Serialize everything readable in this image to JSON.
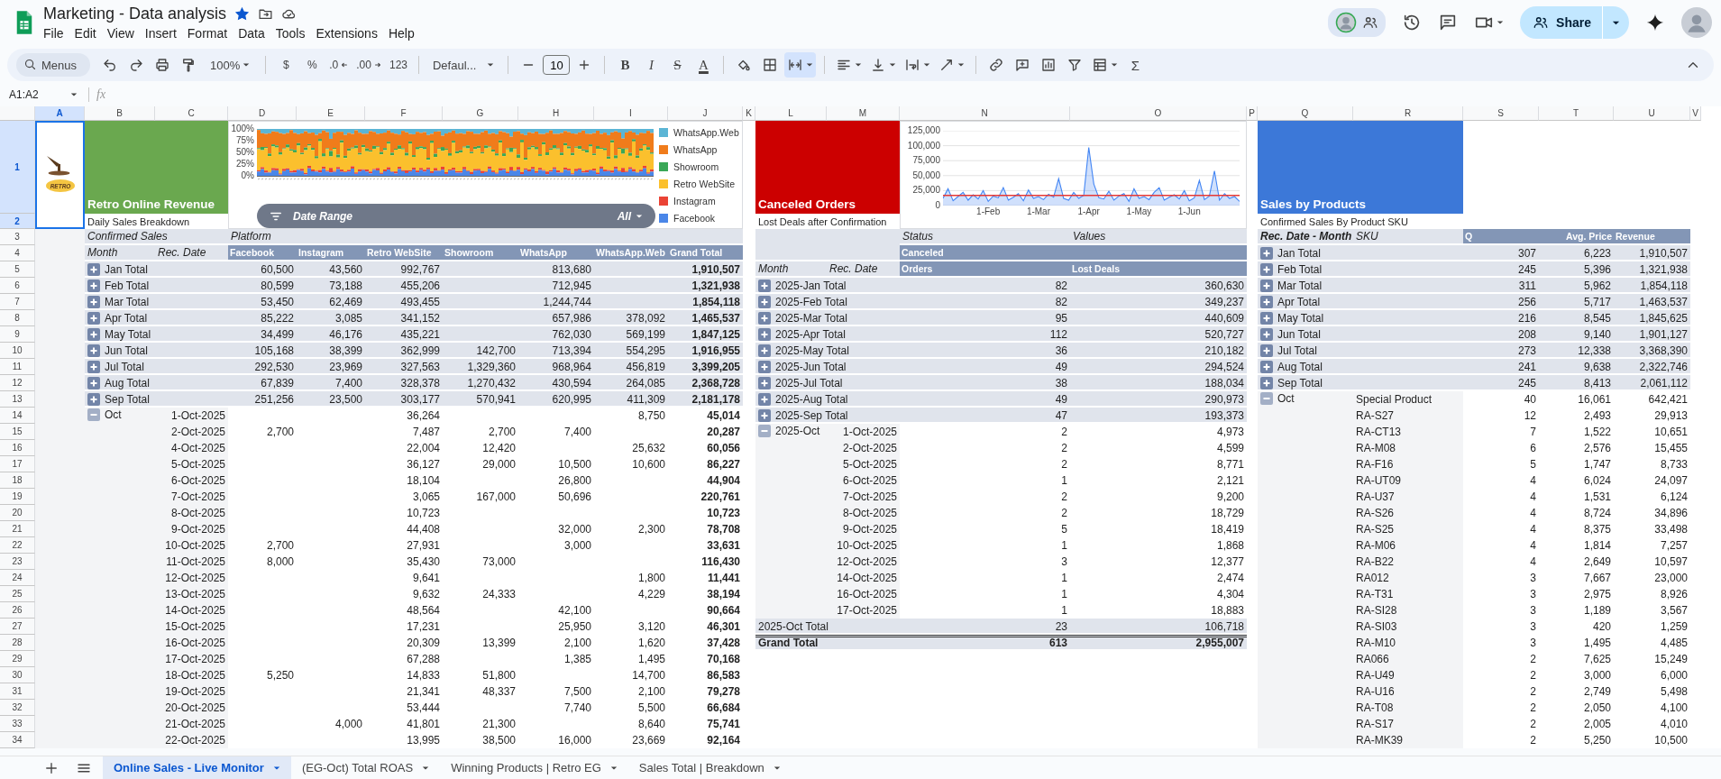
{
  "document": {
    "title": "Marketing - Data analysis",
    "starred": true,
    "menus": [
      "File",
      "Edit",
      "View",
      "Insert",
      "Format",
      "Data",
      "Tools",
      "Extensions",
      "Help"
    ]
  },
  "header": {
    "share_label": "Share"
  },
  "toolbar": {
    "search_placeholder": "Menus",
    "zoom": "100%",
    "number_formats": [
      "$",
      "%",
      ".0",
      ".00",
      "123"
    ],
    "font": "Defaul...",
    "font_size": "10",
    "text_styles": [
      "B",
      "I",
      "S",
      "A"
    ],
    "merge_on": true,
    "function": "Σ"
  },
  "formula_bar": {
    "name_box": "A1:A2",
    "function_label": "fx"
  },
  "columns": [
    {
      "label": "A",
      "selected": true
    },
    {
      "label": "B",
      "selected": false
    },
    {
      "label": "C",
      "selected": false
    },
    {
      "label": "D",
      "selected": false
    },
    {
      "label": "E",
      "selected": false
    },
    {
      "label": "F",
      "selected": false
    },
    {
      "label": "G",
      "selected": false
    },
    {
      "label": "H",
      "selected": false
    },
    {
      "label": "I",
      "selected": false
    },
    {
      "label": "J",
      "selected": false
    },
    {
      "label": "K",
      "selected": false
    },
    {
      "label": "L",
      "selected": false
    },
    {
      "label": "M",
      "selected": false
    },
    {
      "label": "N",
      "selected": false
    },
    {
      "label": "O",
      "selected": false
    },
    {
      "label": "P",
      "selected": false
    },
    {
      "label": "Q",
      "selected": false
    },
    {
      "label": "R",
      "selected": false
    },
    {
      "label": "S",
      "selected": false
    },
    {
      "label": "T",
      "selected": false
    },
    {
      "label": "U",
      "selected": false
    },
    {
      "label": "V",
      "selected": false
    }
  ],
  "rows": [
    {
      "label": "1",
      "selected": true
    },
    {
      "label": "2",
      "selected": true
    },
    {
      "label": "3",
      "selected": false
    },
    {
      "label": "4",
      "selected": false
    },
    {
      "label": "5",
      "selected": false
    },
    {
      "label": "6",
      "selected": false
    },
    {
      "label": "7",
      "selected": false
    },
    {
      "label": "8",
      "selected": false
    },
    {
      "label": "9",
      "selected": false
    },
    {
      "label": "10",
      "selected": false
    },
    {
      "label": "11",
      "selected": false
    },
    {
      "label": "12",
      "selected": false
    },
    {
      "label": "13",
      "selected": false
    },
    {
      "label": "14",
      "selected": false
    },
    {
      "label": "15",
      "selected": false
    },
    {
      "label": "16",
      "selected": false
    },
    {
      "label": "17",
      "selected": false
    },
    {
      "label": "18",
      "selected": false
    },
    {
      "label": "19",
      "selected": false
    },
    {
      "label": "20",
      "selected": false
    },
    {
      "label": "21",
      "selected": false
    },
    {
      "label": "22",
      "selected": false
    },
    {
      "label": "23",
      "selected": false
    },
    {
      "label": "24",
      "selected": false
    },
    {
      "label": "25",
      "selected": false
    },
    {
      "label": "26",
      "selected": false
    },
    {
      "label": "27",
      "selected": false
    },
    {
      "label": "28",
      "selected": false
    },
    {
      "label": "29",
      "selected": false
    },
    {
      "label": "30",
      "selected": false
    },
    {
      "label": "31",
      "selected": false
    },
    {
      "label": "32",
      "selected": false
    },
    {
      "label": "33",
      "selected": false
    },
    {
      "label": "34",
      "selected": false
    }
  ],
  "logo": {
    "text": "RETRO"
  },
  "cards": [
    {
      "title": "Retro Online Revenue",
      "subtitle": "Daily Sales Breakdown",
      "color": "#6aa84f"
    },
    {
      "title": "Canceled Orders",
      "subtitle": "Lost Deals after Confirmation",
      "color": "#cc0000"
    },
    {
      "title": "Sales by Products",
      "subtitle": "Confirmed Sales By Product SKU",
      "color": "#3c78d8"
    }
  ],
  "platform_chart": {
    "yticks": [
      "100%",
      "75%",
      "50%",
      "25%",
      "0%"
    ],
    "legend": [
      {
        "label": "WhatsApp.Web",
        "color": "#5bb5d5"
      },
      {
        "label": "WhatsApp",
        "color": "#f07c1b"
      },
      {
        "label": "Showroom",
        "color": "#3aa757"
      },
      {
        "label": "Retro WebSite",
        "color": "#fbc02d"
      },
      {
        "label": "Instagram",
        "color": "#ea4335"
      },
      {
        "label": "Facebook",
        "color": "#4a86e8"
      }
    ],
    "date_filter": {
      "label": "Date Range",
      "value": "All"
    }
  },
  "cancel_chart": {
    "chart_data": {
      "type": "line",
      "categories": [
        null,
        null,
        null,
        null,
        null,
        null,
        null,
        null,
        null,
        "1-Feb",
        null,
        null,
        null,
        null,
        null,
        null,
        null,
        null,
        null,
        "1-Mar",
        null,
        null,
        null,
        null,
        null,
        null,
        null,
        null,
        null,
        "1-Apr",
        null,
        null,
        null,
        null,
        null,
        null,
        null,
        null,
        null,
        "1-May",
        null,
        null,
        null,
        null,
        null,
        null,
        null,
        null,
        null,
        "1-Jun",
        null,
        null,
        null,
        null,
        null,
        null,
        null,
        null,
        null,
        null
      ],
      "grid": true,
      "series": [
        {
          "type": "area",
          "color": "#4285f4",
          "values": [
            12000,
            28000,
            8000,
            15000,
            22000,
            9000,
            18000,
            11000,
            25000,
            7000,
            16000,
            13000,
            30000,
            9000,
            14000,
            20000,
            8000,
            26000,
            12000,
            15000,
            10000,
            19000,
            14000,
            45000,
            12000,
            9000,
            22000,
            12000,
            17000,
            97000,
            36000,
            13000,
            11000,
            24000,
            9000,
            16000,
            20000,
            7000,
            28000,
            12000,
            15000,
            10000,
            22000,
            30000,
            9000,
            14000,
            18000,
            11000,
            25000,
            8000,
            13000,
            42000,
            10000,
            16000,
            58000,
            9000,
            20000,
            12000,
            15000,
            7000
          ]
        },
        {
          "color": "#e53935",
          "values": [
            17000,
            17000,
            17000,
            17000,
            17000,
            17000,
            17000,
            17000,
            17000,
            17000,
            17000,
            17000,
            17000,
            17000,
            17000,
            17000,
            17000,
            17000,
            17000,
            17000,
            17000,
            17000,
            17000,
            17000,
            17000,
            17000,
            17000,
            17000,
            17000,
            17000,
            17000,
            17000,
            17000,
            17000,
            17000,
            17000,
            17000,
            17000,
            17000,
            17000,
            17000,
            17000,
            17000,
            17000,
            17000,
            17000,
            17000,
            17000,
            17000,
            17000,
            17000,
            17000,
            17000,
            17000,
            17000,
            17000,
            17000,
            17000,
            17000,
            17000
          ]
        }
      ],
      "ylim": [
        0,
        125000
      ],
      "yticks": [
        {
          "value": 0,
          "label": "0"
        },
        {
          "value": 25000,
          "label": "25,000"
        },
        {
          "value": 50000,
          "label": "50,000"
        },
        {
          "value": 75000,
          "label": "75,000"
        },
        {
          "value": 100000,
          "label": "100,000"
        },
        {
          "value": 125000,
          "label": "125,000"
        }
      ]
    }
  },
  "sales_pivot": {
    "corner": "Confirmed Sales",
    "column_field": "Platform",
    "row_fields": [
      "Month",
      "Rec. Date"
    ],
    "columns": [
      "Facebook",
      "Instagram",
      "Retro WebSite",
      "Showroom",
      "WhatsApp",
      "WhatsApp.Web",
      "Grand Total"
    ],
    "groups": [
      {
        "label": "Jan Total",
        "expanded": false,
        "cells": [
          {
            "value": "60,500"
          },
          {
            "value": "43,560"
          },
          {
            "value": "992,767"
          },
          {},
          {
            "value": "813,680"
          },
          {},
          {
            "value": "1,910,507"
          }
        ]
      },
      {
        "label": "Feb Total",
        "expanded": false,
        "cells": [
          {
            "value": "80,599"
          },
          {
            "value": "73,188"
          },
          {
            "value": "455,206"
          },
          {},
          {
            "value": "712,945"
          },
          {},
          {
            "value": "1,321,938"
          }
        ]
      },
      {
        "label": "Mar Total",
        "expanded": false,
        "cells": [
          {
            "value": "53,450"
          },
          {
            "value": "62,469"
          },
          {
            "value": "493,455"
          },
          {},
          {
            "value": "1,244,744"
          },
          {},
          {
            "value": "1,854,118"
          }
        ]
      },
      {
        "label": "Apr Total",
        "expanded": false,
        "cells": [
          {
            "value": "85,222"
          },
          {
            "value": "3,085"
          },
          {
            "value": "341,152"
          },
          {},
          {
            "value": "657,986"
          },
          {
            "value": "378,092"
          },
          {
            "value": "1,465,537"
          }
        ]
      },
      {
        "label": "May Total",
        "expanded": false,
        "cells": [
          {
            "value": "34,499"
          },
          {
            "value": "46,176"
          },
          {
            "value": "435,221"
          },
          {},
          {
            "value": "762,030"
          },
          {
            "value": "569,199"
          },
          {
            "value": "1,847,125"
          }
        ]
      },
      {
        "label": "Jun Total",
        "expanded": false,
        "cells": [
          {
            "value": "105,168"
          },
          {
            "value": "38,399"
          },
          {
            "value": "362,999"
          },
          {
            "value": "142,700"
          },
          {
            "value": "713,394"
          },
          {
            "value": "554,295"
          },
          {
            "value": "1,916,955"
          }
        ]
      },
      {
        "label": "Jul Total",
        "expanded": false,
        "cells": [
          {
            "value": "292,530"
          },
          {
            "value": "23,969"
          },
          {
            "value": "327,563"
          },
          {
            "value": "1,329,360"
          },
          {
            "value": "968,964"
          },
          {
            "value": "456,819"
          },
          {
            "value": "3,399,205"
          }
        ]
      },
      {
        "label": "Aug Total",
        "expanded": false,
        "cells": [
          {
            "value": "67,839"
          },
          {
            "value": "7,400"
          },
          {
            "value": "328,378"
          },
          {
            "value": "1,270,432"
          },
          {
            "value": "430,594"
          },
          {
            "value": "264,085"
          },
          {
            "value": "2,368,728"
          }
        ]
      },
      {
        "label": "Sep Total",
        "expanded": false,
        "cells": [
          {
            "value": "251,256"
          },
          {
            "value": "23,500"
          },
          {
            "value": "303,177"
          },
          {
            "value": "570,941"
          },
          {
            "value": "620,995"
          },
          {
            "value": "411,309"
          },
          {
            "value": "2,181,178"
          }
        ]
      },
      {
        "label": "Oct",
        "expanded": true,
        "children": [
          {
            "label": "1-Oct-2025",
            "cells": [
              {},
              {},
              {
                "value": "36,264"
              },
              {},
              {},
              {
                "value": "8,750"
              },
              {
                "value": "45,014"
              }
            ]
          },
          {
            "label": "2-Oct-2025",
            "cells": [
              {
                "value": "2,700"
              },
              {},
              {
                "value": "7,487"
              },
              {
                "value": "2,700"
              },
              {
                "value": "7,400"
              },
              {},
              {
                "value": "20,287"
              }
            ]
          },
          {
            "label": "4-Oct-2025",
            "cells": [
              {},
              {},
              {
                "value": "22,004"
              },
              {
                "value": "12,420"
              },
              {},
              {
                "value": "25,632"
              },
              {
                "value": "60,056"
              }
            ]
          },
          {
            "label": "5-Oct-2025",
            "cells": [
              {},
              {},
              {
                "value": "36,127"
              },
              {
                "value": "29,000"
              },
              {
                "value": "10,500"
              },
              {
                "value": "10,600"
              },
              {
                "value": "86,227"
              }
            ]
          },
          {
            "label": "6-Oct-2025",
            "cells": [
              {},
              {},
              {
                "value": "18,104"
              },
              {},
              {
                "value": "26,800"
              },
              {},
              {
                "value": "44,904"
              }
            ]
          },
          {
            "label": "7-Oct-2025",
            "cells": [
              {},
              {},
              {
                "value": "3,065"
              },
              {
                "value": "167,000"
              },
              {
                "value": "50,696"
              },
              {},
              {
                "value": "220,761"
              }
            ]
          },
          {
            "label": "8-Oct-2025",
            "cells": [
              {},
              {},
              {
                "value": "10,723"
              },
              {},
              {},
              {},
              {
                "value": "10,723"
              }
            ]
          },
          {
            "label": "9-Oct-2025",
            "cells": [
              {},
              {},
              {
                "value": "44,408"
              },
              {},
              {
                "value": "32,000"
              },
              {
                "value": "2,300"
              },
              {
                "value": "78,708"
              }
            ]
          },
          {
            "label": "10-Oct-2025",
            "cells": [
              {
                "value": "2,700"
              },
              {},
              {
                "value": "27,931"
              },
              {},
              {
                "value": "3,000"
              },
              {},
              {
                "value": "33,631"
              }
            ]
          },
          {
            "label": "11-Oct-2025",
            "cells": [
              {
                "value": "8,000"
              },
              {},
              {
                "value": "35,430"
              },
              {
                "value": "73,000"
              },
              {},
              {},
              {
                "value": "116,430"
              }
            ]
          },
          {
            "label": "12-Oct-2025",
            "cells": [
              {},
              {},
              {
                "value": "9,641"
              },
              {},
              {},
              {
                "value": "1,800"
              },
              {
                "value": "11,441"
              }
            ]
          },
          {
            "label": "13-Oct-2025",
            "cells": [
              {},
              {},
              {
                "value": "9,632"
              },
              {
                "value": "24,333"
              },
              {},
              {
                "value": "4,229"
              },
              {
                "value": "38,194"
              }
            ]
          },
          {
            "label": "14-Oct-2025",
            "cells": [
              {},
              {},
              {
                "value": "48,564"
              },
              {},
              {
                "value": "42,100"
              },
              {},
              {
                "value": "90,664"
              }
            ]
          },
          {
            "label": "15-Oct-2025",
            "cells": [
              {},
              {},
              {
                "value": "17,231"
              },
              {},
              {
                "value": "25,950"
              },
              {
                "value": "3,120"
              },
              {
                "value": "46,301"
              }
            ]
          },
          {
            "label": "16-Oct-2025",
            "cells": [
              {},
              {},
              {
                "value": "20,309"
              },
              {
                "value": "13,399"
              },
              {
                "value": "2,100"
              },
              {
                "value": "1,620"
              },
              {
                "value": "37,428"
              }
            ]
          },
          {
            "label": "17-Oct-2025",
            "cells": [
              {},
              {},
              {
                "value": "67,288"
              },
              {},
              {
                "value": "1,385"
              },
              {
                "value": "1,495"
              },
              {
                "value": "70,168"
              }
            ]
          },
          {
            "label": "18-Oct-2025",
            "cells": [
              {
                "value": "5,250"
              },
              {},
              {
                "value": "14,833"
              },
              {
                "value": "51,800"
              },
              {},
              {
                "value": "14,700"
              },
              {
                "value": "86,583"
              }
            ]
          },
          {
            "label": "19-Oct-2025",
            "cells": [
              {},
              {},
              {
                "value": "21,341"
              },
              {
                "value": "48,337"
              },
              {
                "value": "7,500"
              },
              {
                "value": "2,100"
              },
              {
                "value": "79,278"
              }
            ]
          },
          {
            "label": "20-Oct-2025",
            "cells": [
              {},
              {},
              {
                "value": "53,444"
              },
              {},
              {
                "value": "7,740"
              },
              {
                "value": "5,500"
              },
              {
                "value": "66,684"
              }
            ]
          },
          {
            "label": "21-Oct-2025",
            "cells": [
              {},
              {
                "value": "4,000"
              },
              {
                "value": "41,801"
              },
              {
                "value": "21,300"
              },
              {},
              {
                "value": "8,640"
              },
              {
                "value": "75,741"
              }
            ]
          },
          {
            "label": "22-Oct-2025",
            "cells": [
              {},
              {},
              {
                "value": "13,995"
              },
              {
                "value": "38,500"
              },
              {
                "value": "16,000"
              },
              {
                "value": "23,669"
              },
              {
                "value": "92,164"
              }
            ]
          }
        ]
      }
    ]
  },
  "cancel_pivot": {
    "column_field": "Status",
    "values_label": "Values",
    "status": "Canceled",
    "row_fields": [
      "Month",
      "Rec. Date"
    ],
    "columns": [
      "Orders",
      "Lost Deals"
    ],
    "groups": [
      {
        "label": "2025-Jan Total",
        "expanded": false,
        "values": [
          "82",
          "360,630"
        ]
      },
      {
        "label": "2025-Feb Total",
        "expanded": false,
        "values": [
          "82",
          "349,237"
        ]
      },
      {
        "label": "2025-Mar Total",
        "expanded": false,
        "values": [
          "95",
          "440,609"
        ]
      },
      {
        "label": "2025-Apr Total",
        "expanded": false,
        "values": [
          "112",
          "520,727"
        ]
      },
      {
        "label": "2025-May Total",
        "expanded": false,
        "values": [
          "36",
          "210,182"
        ]
      },
      {
        "label": "2025-Jun Total",
        "expanded": false,
        "values": [
          "49",
          "294,524"
        ]
      },
      {
        "label": "2025-Jul Total",
        "expanded": false,
        "values": [
          "38",
          "188,034"
        ]
      },
      {
        "label": "2025-Aug Total",
        "expanded": false,
        "values": [
          "49",
          "290,973"
        ]
      },
      {
        "label": "2025-Sep Total",
        "expanded": false,
        "values": [
          "47",
          "193,373"
        ]
      },
      {
        "label": "2025-Oct",
        "expanded": true,
        "children": [
          {
            "label": "1-Oct-2025",
            "values": [
              "2",
              "4,973"
            ]
          },
          {
            "label": "2-Oct-2025",
            "values": [
              "2",
              "4,599"
            ]
          },
          {
            "label": "5-Oct-2025",
            "values": [
              "2",
              "8,771"
            ]
          },
          {
            "label": "6-Oct-2025",
            "values": [
              "1",
              "2,121"
            ]
          },
          {
            "label": "7-Oct-2025",
            "values": [
              "2",
              "9,200"
            ]
          },
          {
            "label": "8-Oct-2025",
            "values": [
              "2",
              "18,729"
            ]
          },
          {
            "label": "9-Oct-2025",
            "values": [
              "5",
              "18,419"
            ]
          },
          {
            "label": "10-Oct-2025",
            "values": [
              "1",
              "1,868"
            ]
          },
          {
            "label": "12-Oct-2025",
            "values": [
              "3",
              "12,377"
            ]
          },
          {
            "label": "14-Oct-2025",
            "values": [
              "1",
              "2,474"
            ]
          },
          {
            "label": "16-Oct-2025",
            "values": [
              "1",
              "4,304"
            ]
          },
          {
            "label": "17-Oct-2025",
            "values": [
              "1",
              "18,883"
            ]
          }
        ]
      }
    ],
    "totals": [
      {
        "label": "2025-Oct Total",
        "values": [
          "23",
          "106,718"
        ]
      },
      {
        "label": "Grand Total",
        "values": [
          "613",
          "2,955,007"
        ]
      }
    ]
  },
  "product_pivot": {
    "row_fields": [
      "Rec. Date - Month",
      "SKU"
    ],
    "columns": [
      "Q",
      "Avg. Price",
      "Revenue"
    ],
    "groups": [
      {
        "label": "Jan Total",
        "expanded": false,
        "values": [
          "307",
          "6,223",
          "1,910,507"
        ]
      },
      {
        "label": "Feb Total",
        "expanded": false,
        "values": [
          "245",
          "5,396",
          "1,321,938"
        ]
      },
      {
        "label": "Mar Total",
        "expanded": false,
        "values": [
          "311",
          "5,962",
          "1,854,118"
        ]
      },
      {
        "label": "Apr Total",
        "expanded": false,
        "values": [
          "256",
          "5,717",
          "1,463,537"
        ]
      },
      {
        "label": "May Total",
        "expanded": false,
        "values": [
          "216",
          "8,545",
          "1,845,625"
        ]
      },
      {
        "label": "Jun Total",
        "expanded": false,
        "values": [
          "208",
          "9,140",
          "1,901,127"
        ]
      },
      {
        "label": "Jul Total",
        "expanded": false,
        "values": [
          "273",
          "12,338",
          "3,368,390"
        ]
      },
      {
        "label": "Aug Total",
        "expanded": false,
        "values": [
          "241",
          "9,638",
          "2,322,746"
        ]
      },
      {
        "label": "Sep Total",
        "expanded": false,
        "values": [
          "245",
          "8,413",
          "2,061,112"
        ]
      },
      {
        "label": "Oct",
        "expanded": true,
        "children": [
          {
            "label": "Special Product",
            "values": [
              "40",
              "16,061",
              "642,421"
            ]
          },
          {
            "label": "RA-S27",
            "values": [
              "12",
              "2,493",
              "29,913"
            ]
          },
          {
            "label": "RA-CT13",
            "values": [
              "7",
              "1,522",
              "10,651"
            ]
          },
          {
            "label": "RA-M08",
            "values": [
              "6",
              "2,576",
              "15,455"
            ]
          },
          {
            "label": "RA-F16",
            "values": [
              "5",
              "1,747",
              "8,733"
            ]
          },
          {
            "label": "RA-UT09",
            "values": [
              "4",
              "6,024",
              "24,097"
            ]
          },
          {
            "label": "RA-U37",
            "values": [
              "4",
              "1,531",
              "6,124"
            ]
          },
          {
            "label": "RA-S26",
            "values": [
              "4",
              "8,724",
              "34,896"
            ]
          },
          {
            "label": "RA-S25",
            "values": [
              "4",
              "8,375",
              "33,498"
            ]
          },
          {
            "label": "RA-M06",
            "values": [
              "4",
              "1,814",
              "7,257"
            ]
          },
          {
            "label": "RA-B22",
            "values": [
              "4",
              "2,649",
              "10,597"
            ]
          },
          {
            "label": "RA012",
            "values": [
              "3",
              "7,667",
              "23,000"
            ]
          },
          {
            "label": "RA-T31",
            "values": [
              "3",
              "2,975",
              "8,926"
            ]
          },
          {
            "label": "RA-SI28",
            "values": [
              "3",
              "1,189",
              "3,567"
            ]
          },
          {
            "label": "RA-SI03",
            "values": [
              "3",
              "420",
              "1,259"
            ]
          },
          {
            "label": "RA-M10",
            "values": [
              "3",
              "1,495",
              "4,485"
            ]
          },
          {
            "label": "RA066",
            "values": [
              "2",
              "7,625",
              "15,249"
            ]
          },
          {
            "label": "RA-U49",
            "values": [
              "2",
              "3,000",
              "6,000"
            ]
          },
          {
            "label": "RA-U16",
            "values": [
              "2",
              "2,749",
              "5,498"
            ]
          },
          {
            "label": "RA-T08",
            "values": [
              "2",
              "2,050",
              "4,100"
            ]
          },
          {
            "label": "RA-S17",
            "values": [
              "2",
              "2,005",
              "4,010"
            ]
          },
          {
            "label": "RA-MK39",
            "values": [
              "2",
              "5,250",
              "10,500"
            ]
          }
        ]
      }
    ]
  },
  "sheet_tabs": [
    {
      "label": "Online Sales - Live Monitor",
      "selected": true
    },
    {
      "label": "(EG-Oct) Total ROAS",
      "selected": false
    },
    {
      "label": "Winning Products | Retro EG",
      "selected": false
    },
    {
      "label": "Sales Total | Breakdown",
      "selected": false
    }
  ]
}
